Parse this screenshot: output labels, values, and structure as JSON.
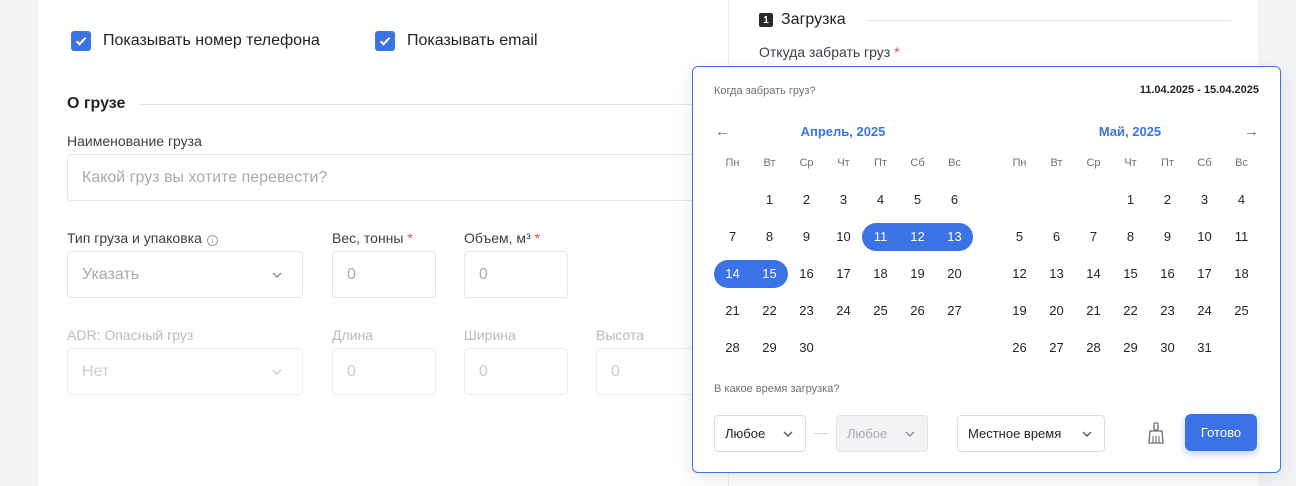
{
  "checkboxes": [
    {
      "label": "Показывать номер телефона",
      "checked": true
    },
    {
      "label": "Показывать email",
      "checked": true
    }
  ],
  "cargo_section": {
    "title": "О грузе",
    "name_label": "Наименование груза",
    "name_placeholder": "Какой груз вы хотите перевести?",
    "type_label": "Тип груза и упаковка",
    "type_value": "Указать",
    "weight_label": "Вес, тонны",
    "weight_value": "0",
    "volume_label": "Объем, м³",
    "volume_value": "0",
    "adr_label": "ADR: Опасный груз",
    "adr_value": "Нет",
    "length_label": "Длина",
    "length_value": "0",
    "width_label": "Ширина",
    "width_value": "0",
    "height_label": "Высота",
    "height_value": "0",
    "required_mark": "*"
  },
  "loading_section": {
    "step": "1",
    "title": "Загрузка",
    "from_label": "Откуда забрать груз"
  },
  "datepicker": {
    "question": "Когда забрать груз?",
    "range": "11.04.2025 - 15.04.2025",
    "prev_arrow": "←",
    "next_arrow": "→",
    "weekdays": [
      "Пн",
      "Вт",
      "Ср",
      "Чт",
      "Пт",
      "Сб",
      "Вс"
    ],
    "months": [
      {
        "title": "Апрель, 2025",
        "first_weekday": 1,
        "days": 30
      },
      {
        "title": "Май, 2025",
        "first_weekday": 3,
        "days": 31
      }
    ],
    "selected_month": 0,
    "selected_from": 11,
    "selected_to": 15,
    "time_question": "В какое время загрузка?",
    "time_from": "Любое",
    "time_to": "Любое",
    "timezone": "Местное время",
    "done_label": "Готово",
    "accent_color": "#3b73e6"
  }
}
